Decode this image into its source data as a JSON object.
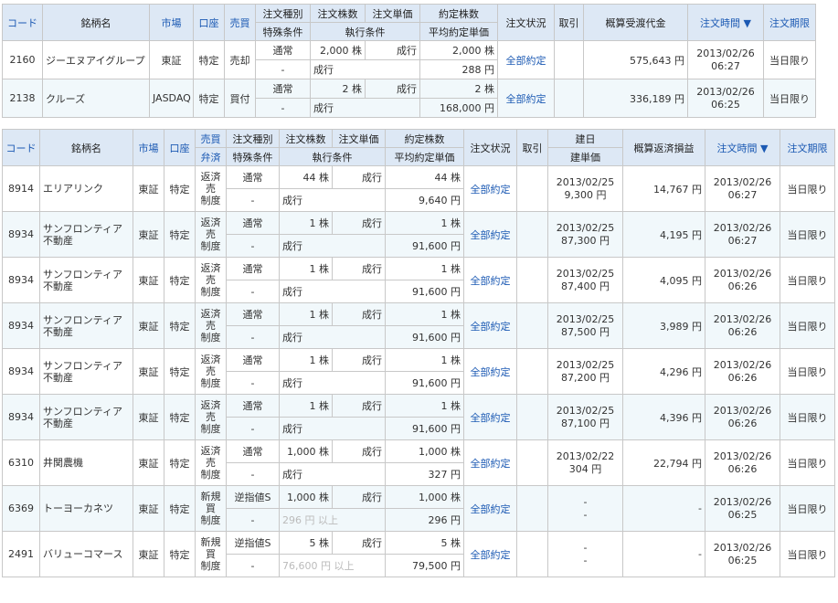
{
  "table1": {
    "headers": {
      "code": "コード",
      "name": "銘柄名",
      "market": "市場",
      "account": "口座",
      "side": "売買",
      "order_type": "注文種別",
      "special": "特殊条件",
      "qty": "注文株数",
      "price": "注文単価",
      "exec_cond": "執行条件",
      "filled_qty": "約定株数",
      "avg_price": "平均約定単価",
      "status": "注文状況",
      "cancel": "取引",
      "amount": "概算受渡代金",
      "time": "注文時間 ▼",
      "expiry": "注文期限"
    },
    "rows": [
      {
        "code": "2160",
        "name": "ジーエヌアイグループ",
        "market": "東証",
        "account": "特定",
        "side": "売却",
        "order_type": "通常",
        "special": "-",
        "qty": "2,000 株",
        "price_label": "成行",
        "exec": "成行",
        "filled": "2,000 株",
        "avg": "288 円",
        "status": "全部約定",
        "amount": "575,643 円",
        "date": "2013/02/26",
        "time": "06:27",
        "expiry": "当日限り"
      },
      {
        "code": "2138",
        "name": "クルーズ",
        "market": "JASDAQ",
        "account": "特定",
        "side": "買付",
        "order_type": "通常",
        "special": "-",
        "qty": "2 株",
        "price_label": "成行",
        "exec": "成行",
        "filled": "2 株",
        "avg": "168,000 円",
        "status": "全部約定",
        "amount": "336,189 円",
        "date": "2013/02/26",
        "time": "06:25",
        "expiry": "当日限り"
      }
    ]
  },
  "table2": {
    "headers": {
      "code": "コード",
      "name": "銘柄名",
      "market": "市場",
      "account": "口座",
      "side1": "売買",
      "side2": "弁済",
      "order_type": "注文種別",
      "special": "特殊条件",
      "qty": "注文株数",
      "price": "注文単価",
      "exec_cond": "執行条件",
      "filled_qty": "約定株数",
      "avg_price": "平均約定単価",
      "status": "注文状況",
      "cancel": "取引",
      "open_date": "建日",
      "open_price": "建単価",
      "pl": "概算返済損益",
      "time": "注文時間 ▼",
      "expiry": "注文期限"
    },
    "rows": [
      {
        "code": "8914",
        "name1": "エリアリンク",
        "name2": "",
        "market": "東証",
        "account": "特定",
        "s1": "返済",
        "s2": "売",
        "s3": "制度",
        "order_type": "通常",
        "special": "-",
        "qty": "44 株",
        "price_label": "成行",
        "exec": "成行",
        "exec_gray": false,
        "filled": "44 株",
        "avg": "9,640 円",
        "status": "全部約定",
        "open_date": "2013/02/25",
        "open_price": "9,300 円",
        "pl": "14,767 円",
        "date": "2013/02/26",
        "time": "06:27",
        "expiry": "当日限り"
      },
      {
        "code": "8934",
        "name1": "サンフロンティア",
        "name2": "不動産",
        "market": "東証",
        "account": "特定",
        "s1": "返済",
        "s2": "売",
        "s3": "制度",
        "order_type": "通常",
        "special": "-",
        "qty": "1 株",
        "price_label": "成行",
        "exec": "成行",
        "exec_gray": false,
        "filled": "1 株",
        "avg": "91,600 円",
        "status": "全部約定",
        "open_date": "2013/02/25",
        "open_price": "87,300 円",
        "pl": "4,195 円",
        "date": "2013/02/26",
        "time": "06:27",
        "expiry": "当日限り"
      },
      {
        "code": "8934",
        "name1": "サンフロンティア",
        "name2": "不動産",
        "market": "東証",
        "account": "特定",
        "s1": "返済",
        "s2": "売",
        "s3": "制度",
        "order_type": "通常",
        "special": "-",
        "qty": "1 株",
        "price_label": "成行",
        "exec": "成行",
        "exec_gray": false,
        "filled": "1 株",
        "avg": "91,600 円",
        "status": "全部約定",
        "open_date": "2013/02/25",
        "open_price": "87,400 円",
        "pl": "4,095 円",
        "date": "2013/02/26",
        "time": "06:26",
        "expiry": "当日限り"
      },
      {
        "code": "8934",
        "name1": "サンフロンティア",
        "name2": "不動産",
        "market": "東証",
        "account": "特定",
        "s1": "返済",
        "s2": "売",
        "s3": "制度",
        "order_type": "通常",
        "special": "-",
        "qty": "1 株",
        "price_label": "成行",
        "exec": "成行",
        "exec_gray": false,
        "filled": "1 株",
        "avg": "91,600 円",
        "status": "全部約定",
        "open_date": "2013/02/25",
        "open_price": "87,500 円",
        "pl": "3,989 円",
        "date": "2013/02/26",
        "time": "06:26",
        "expiry": "当日限り"
      },
      {
        "code": "8934",
        "name1": "サンフロンティア",
        "name2": "不動産",
        "market": "東証",
        "account": "特定",
        "s1": "返済",
        "s2": "売",
        "s3": "制度",
        "order_type": "通常",
        "special": "-",
        "qty": "1 株",
        "price_label": "成行",
        "exec": "成行",
        "exec_gray": false,
        "filled": "1 株",
        "avg": "91,600 円",
        "status": "全部約定",
        "open_date": "2013/02/25",
        "open_price": "87,200 円",
        "pl": "4,296 円",
        "date": "2013/02/26",
        "time": "06:26",
        "expiry": "当日限り"
      },
      {
        "code": "8934",
        "name1": "サンフロンティア",
        "name2": "不動産",
        "market": "東証",
        "account": "特定",
        "s1": "返済",
        "s2": "売",
        "s3": "制度",
        "order_type": "通常",
        "special": "-",
        "qty": "1 株",
        "price_label": "成行",
        "exec": "成行",
        "exec_gray": false,
        "filled": "1 株",
        "avg": "91,600 円",
        "status": "全部約定",
        "open_date": "2013/02/25",
        "open_price": "87,100 円",
        "pl": "4,396 円",
        "date": "2013/02/26",
        "time": "06:26",
        "expiry": "当日限り"
      },
      {
        "code": "6310",
        "name1": "井関農機",
        "name2": "",
        "market": "東証",
        "account": "特定",
        "s1": "返済",
        "s2": "売",
        "s3": "制度",
        "order_type": "通常",
        "special": "-",
        "qty": "1,000 株",
        "price_label": "成行",
        "exec": "成行",
        "exec_gray": false,
        "filled": "1,000 株",
        "avg": "327 円",
        "status": "全部約定",
        "open_date": "2013/02/22",
        "open_price": "304 円",
        "pl": "22,794 円",
        "date": "2013/02/26",
        "time": "06:26",
        "expiry": "当日限り"
      },
      {
        "code": "6369",
        "name1": "トーヨーカネツ",
        "name2": "",
        "market": "東証",
        "account": "特定",
        "s1": "新規",
        "s2": "買",
        "s3": "制度",
        "order_type": "逆指値S",
        "special": "-",
        "qty": "1,000 株",
        "price_label": "成行",
        "exec": "296 円 以上",
        "exec_gray": true,
        "filled": "1,000 株",
        "avg": "296 円",
        "status": "全部約定",
        "open_date": "-",
        "open_price": "-",
        "pl": "-",
        "date": "2013/02/26",
        "time": "06:25",
        "expiry": "当日限り"
      },
      {
        "code": "2491",
        "name1": "バリューコマース",
        "name2": "",
        "market": "東証",
        "account": "特定",
        "s1": "新規",
        "s2": "買",
        "s3": "制度",
        "order_type": "逆指値S",
        "special": "-",
        "qty": "5 株",
        "price_label": "成行",
        "exec": "76,600 円 以上",
        "exec_gray": true,
        "filled": "5 株",
        "avg": "79,500 円",
        "status": "全部約定",
        "open_date": "-",
        "open_price": "-",
        "pl": "-",
        "date": "2013/02/26",
        "time": "06:25",
        "expiry": "当日限り"
      }
    ]
  }
}
